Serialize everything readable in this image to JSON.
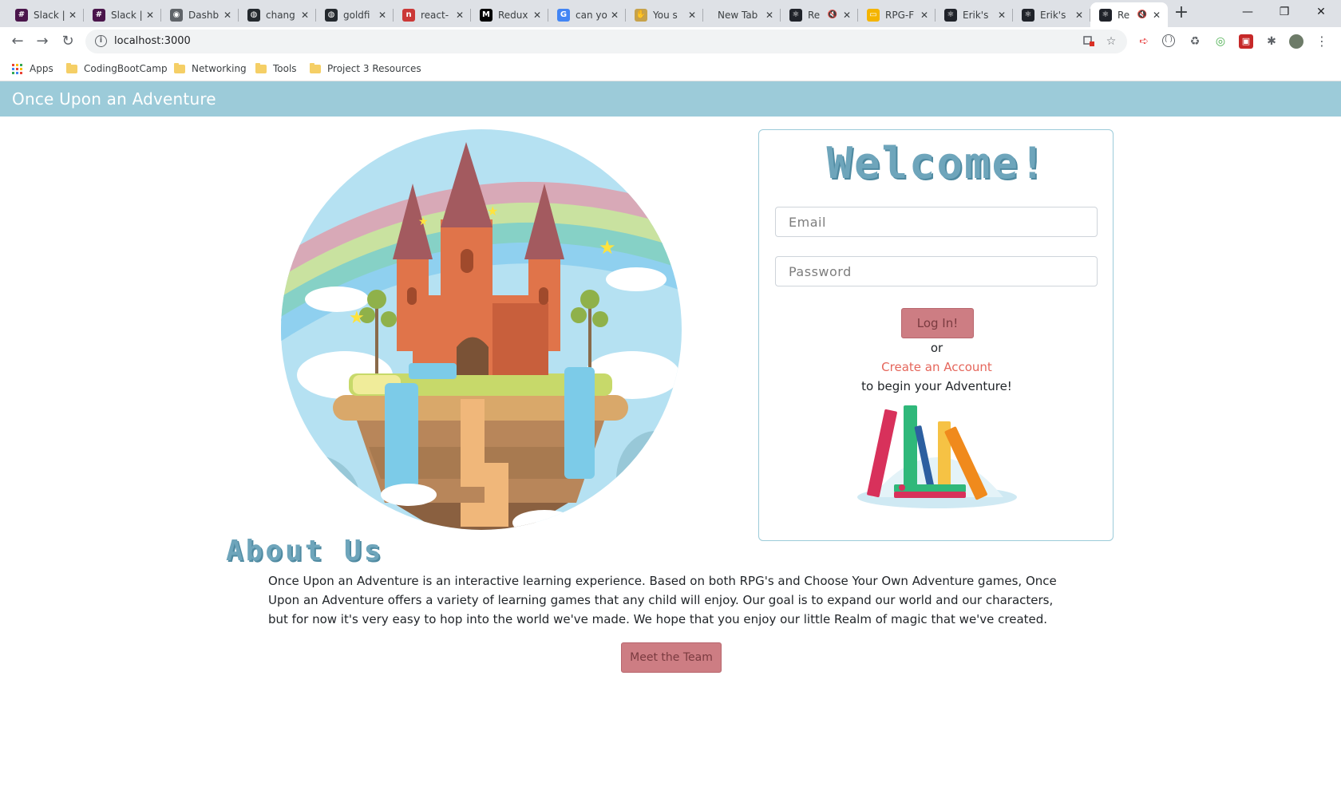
{
  "browser": {
    "tabs": [
      {
        "title": "Slack |",
        "icon": "slack-icon",
        "color": "#4a154b"
      },
      {
        "title": "Slack |",
        "icon": "slack-icon",
        "color": "#4a154b"
      },
      {
        "title": "Dashb",
        "icon": "globe-icon",
        "color": "#5f6368"
      },
      {
        "title": "chang",
        "icon": "github-icon",
        "color": "#24292e"
      },
      {
        "title": "goldfi",
        "icon": "github-icon",
        "color": "#24292e"
      },
      {
        "title": "react-",
        "icon": "npm-icon",
        "color": "#cb3837"
      },
      {
        "title": "Redux",
        "icon": "medium-icon",
        "color": "#000000"
      },
      {
        "title": "can yo",
        "icon": "google-icon",
        "color": "#4285f4"
      },
      {
        "title": "You s",
        "icon": "hand-icon",
        "color": "#c7a24a"
      },
      {
        "title": "New Tab",
        "icon": "",
        "color": ""
      },
      {
        "title": "Re",
        "icon": "react-icon",
        "color": "#20232a",
        "muted": true
      },
      {
        "title": "RPG-F",
        "icon": "slides-icon",
        "color": "#f4b400"
      },
      {
        "title": "Erik's",
        "icon": "react-icon",
        "color": "#20232a"
      },
      {
        "title": "Erik's",
        "icon": "react-icon",
        "color": "#20232a"
      },
      {
        "title": "Re",
        "icon": "react-icon",
        "color": "#20232a",
        "muted": true,
        "active": true
      }
    ],
    "new_tab": "+",
    "window_controls": {
      "minimize": "—",
      "restore": "❐",
      "close": "✕"
    },
    "url": "localhost:3000",
    "bookmarks": [
      {
        "label": "Apps",
        "type": "apps"
      },
      {
        "label": "CodingBootCamp",
        "type": "folder"
      },
      {
        "label": "Networking",
        "type": "folder"
      },
      {
        "label": "Tools",
        "type": "folder"
      },
      {
        "label": "Project 3 Resources",
        "type": "folder"
      }
    ]
  },
  "site": {
    "brand": "Once Upon an Adventure",
    "colors": {
      "navbar": "#9ccbd9",
      "title": "#6ea5bb",
      "button": "#cd7d83",
      "link": "#e5665b"
    }
  },
  "login": {
    "heading": "Welcome!",
    "email_placeholder": "Email",
    "password_placeholder": "Password",
    "login_button": "Log In!",
    "or_text": "or",
    "create_link": "Create an Account",
    "begin_text": "to begin your Adventure!"
  },
  "about": {
    "heading": "About Us",
    "body": "Once Upon an Adventure is an interactive learning experience. Based on both RPG's and Choose Your Own Adventure games, Once Upon an Adventure offers a variety of learning games that any child will enjoy. Our goal is to expand our world and our characters, but for now it's very easy to hop into the world we've made. We hope that you enjoy our little Realm of magic that we've created.",
    "team_button": "Meet the Team"
  }
}
